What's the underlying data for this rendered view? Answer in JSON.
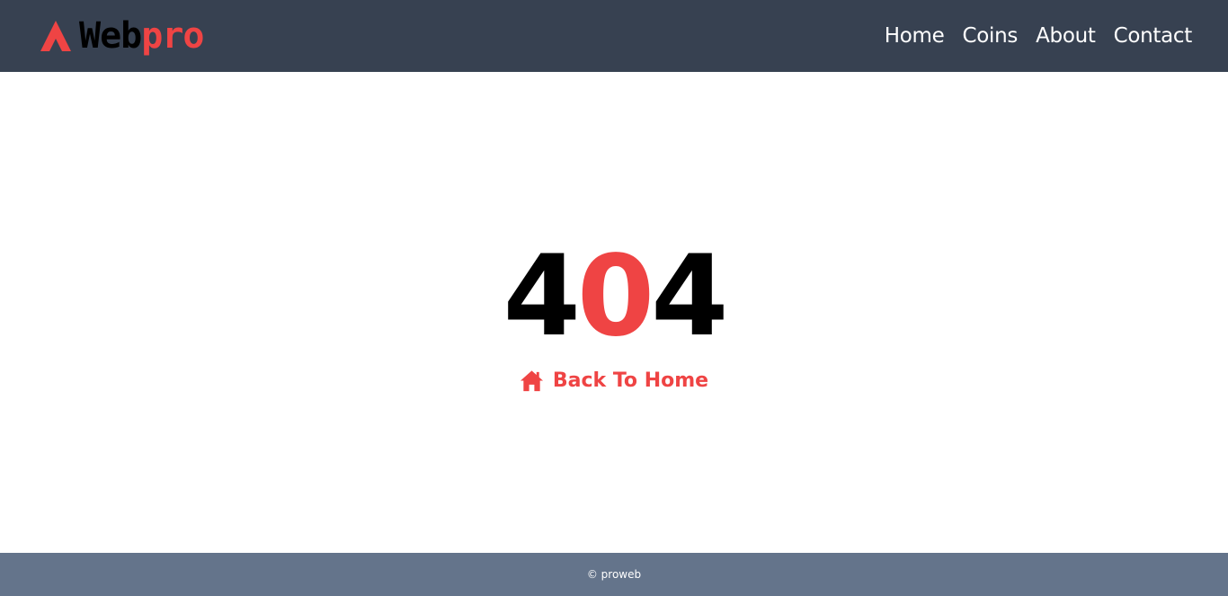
{
  "navbar": {
    "brand": {
      "icon": "arrow-up-icon",
      "text_primary": "Web",
      "text_accent": "pro"
    },
    "links": [
      "Home",
      "Coins",
      "About",
      "Contact"
    ]
  },
  "main": {
    "error_code": {
      "first": "4",
      "middle": "0",
      "last": "4"
    },
    "back_link": {
      "icon": "home-icon",
      "label": "Back To Home"
    }
  },
  "footer": {
    "text": "© proweb"
  },
  "colors": {
    "navbar_bg": "#374151",
    "accent": "#ef4444",
    "footer_bg": "#64748b",
    "page_bg": "#ffffff"
  }
}
